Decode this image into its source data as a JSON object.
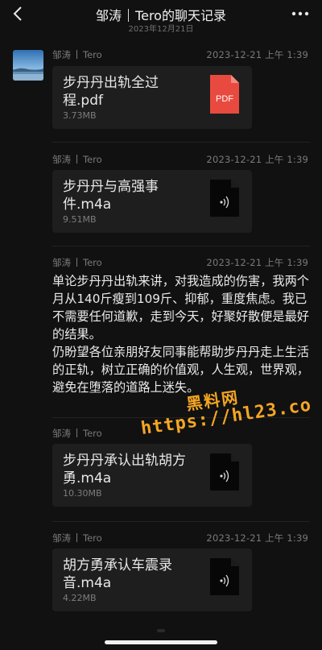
{
  "header": {
    "title_name": "邹涛",
    "title_suffix": "Tero的聊天记录",
    "date": "2023年12月21日"
  },
  "messages": [
    {
      "sender_name": "邹涛",
      "sender_contact": "Tero",
      "time": "2023-12-21 上午 1:39",
      "type": "file",
      "file_name": "步丹丹出轨全过程.pdf",
      "file_size": "3.73MB",
      "icon": "pdf-icon",
      "icon_label": "PDF"
    },
    {
      "sender_name": "邹涛",
      "sender_contact": "Tero",
      "time": "2023-12-21 上午 1:39",
      "type": "file",
      "file_name": "步丹丹与高强事件.m4a",
      "file_size": "9.51MB",
      "icon": "audio-file-icon"
    },
    {
      "sender_name": "邹涛",
      "sender_contact": "Tero",
      "time": "2023-12-21 上午 1:39",
      "type": "text",
      "text": "单论步丹丹出轨来讲，对我造成的伤害，我两个月从140斤瘦到109斤、抑郁，重度焦虑。我已不需要任何道歉，走到今天，好聚好散便是最好的结果。\n仍盼望各位亲朋好友同事能帮助步丹丹走上生活的正轨，树立正确的价值观，人生观，世界观，避免在堕落的道路上迷失。"
    },
    {
      "sender_name": "邹涛",
      "sender_contact": "Tero",
      "time": "",
      "type": "file",
      "file_name": "步丹丹承认出轨胡方勇.m4a",
      "file_size": "10.30MB",
      "icon": "audio-file-icon"
    },
    {
      "sender_name": "邹涛",
      "sender_contact": "Tero",
      "time": "2023-12-21 上午 1:39",
      "type": "file",
      "file_name": "胡方勇承认车震录音.m4a",
      "file_size": "4.22MB",
      "icon": "audio-file-icon"
    }
  ],
  "watermark": {
    "title": "黑料网",
    "url": "https://hl23.co"
  },
  "colors": {
    "background": "#111111",
    "card": "#1e1e1e",
    "pdf_red": "#e94a3f",
    "watermark": "#f5a623"
  }
}
